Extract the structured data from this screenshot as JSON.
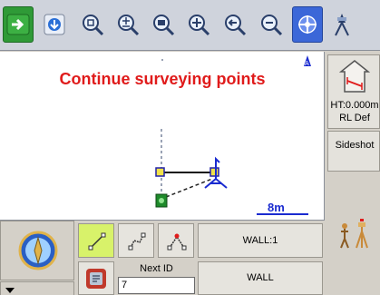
{
  "toolbar": {
    "buttons": [
      {
        "name": "exit-arrow-icon"
      },
      {
        "name": "download-icon"
      },
      {
        "name": "zoom-extents-icon"
      },
      {
        "name": "zoom-in-out-icon"
      },
      {
        "name": "zoom-window-icon"
      },
      {
        "name": "pan-icon"
      },
      {
        "name": "zoom-previous-icon"
      },
      {
        "name": "target-icon"
      },
      {
        "name": "settings-icon"
      }
    ]
  },
  "map": {
    "status_message": "Continue surveying points",
    "scale_label": "8m"
  },
  "right_panel": {
    "height_text": "HT:0.000m",
    "rl_text": "RL Def",
    "sideshot_label": "Sideshot"
  },
  "bottom": {
    "wall_code": "WALL:1",
    "next_id_label": "Next ID",
    "next_id_value": "7",
    "code_button": "WALL"
  },
  "colors": {
    "status_red": "#e01b1b",
    "scale_blue": "#1a2bd0",
    "active_mode": "#d8f26a"
  }
}
